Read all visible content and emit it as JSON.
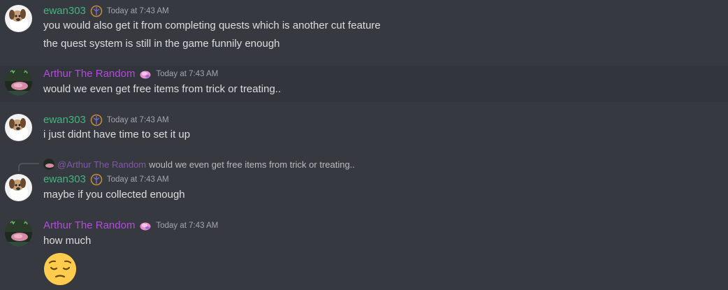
{
  "colors": {
    "background": "#36393f",
    "username_green": "#43b581",
    "username_purple": "#b44ade",
    "text": "#dcddde",
    "timestamp": "#a3a6aa"
  },
  "messages": [
    {
      "author": "ewan303",
      "badge": "ornate-badge-icon",
      "timestamp": "Today at 7:43 AM",
      "lines": [
        "you would also get it from completing quests which is another cut feature",
        "the quest system is still in the game funnily enough"
      ]
    },
    {
      "author": "Arthur The Random",
      "badge": "shell-badge-icon",
      "timestamp": "Today at 7:43 AM",
      "lines": [
        "would we even get free items from trick or treating.."
      ]
    },
    {
      "author": "ewan303",
      "badge": "ornate-badge-icon",
      "timestamp": "Today at 7:43 AM",
      "lines": [
        "i just didnt have time to set it up"
      ]
    },
    {
      "reply": {
        "mention": "@Arthur The Random",
        "text": "would we even get free items from trick or treating.."
      },
      "author": "ewan303",
      "badge": "ornate-badge-icon",
      "timestamp": "Today at 7:43 AM",
      "lines": [
        "maybe if you collected enough"
      ]
    },
    {
      "author": "Arthur The Random",
      "badge": "shell-badge-icon",
      "timestamp": "Today at 7:43 AM",
      "lines": [
        "how much"
      ],
      "emoji": "pensive-face-emoji"
    }
  ]
}
